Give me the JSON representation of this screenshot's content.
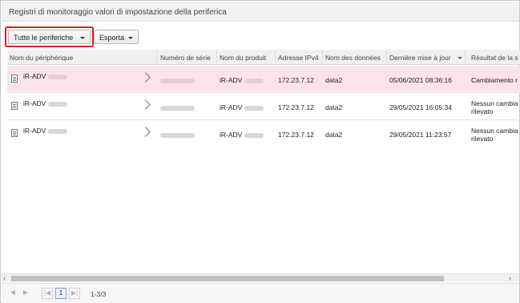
{
  "title": "Registri di monitoraggio valori di impostazione della periferica",
  "toolbar": {
    "device_filter_label": "Tutte le periferiche",
    "export_label": "Esporta"
  },
  "columns": [
    "Nom du périphérique",
    "Numéro de série",
    "Nom du produit",
    "Adresse IPv4",
    "Nom des données",
    "Dernière mise à jour",
    "Résultat de la s"
  ],
  "rows": [
    {
      "device": "iR-ADV",
      "product": "iR-ADV",
      "ip": "172.23.7.12",
      "data": "data2",
      "updated": "05/06/2021 08:36:16",
      "result_l1": "Cambiamento r",
      "result_l2": ""
    },
    {
      "device": "iR-ADV",
      "product": "iR-ADV",
      "ip": "172.23.7.12",
      "data": "data2",
      "updated": "29/05/2021 16:05:34",
      "result_l1": "Nessun cambia",
      "result_l2": "rilevato"
    },
    {
      "device": "iR-ADV",
      "product": "iR-ADV",
      "ip": "172.23.7.12",
      "data": "data2",
      "updated": "29/05/2021 11:23:57",
      "result_l1": "Nessun cambia",
      "result_l2": "rilevato"
    }
  ],
  "pager": {
    "prev_icon": "◀",
    "next_icon": "▶",
    "first_icon": "|◀",
    "last_icon": "▶|",
    "current_page": "1",
    "range_text": "1-3/3"
  },
  "scrollbar": {
    "left_icon": "‹",
    "right_icon": "›"
  },
  "colors": {
    "selected_row": "#fbe4e9",
    "highlight_border": "#e02020"
  }
}
